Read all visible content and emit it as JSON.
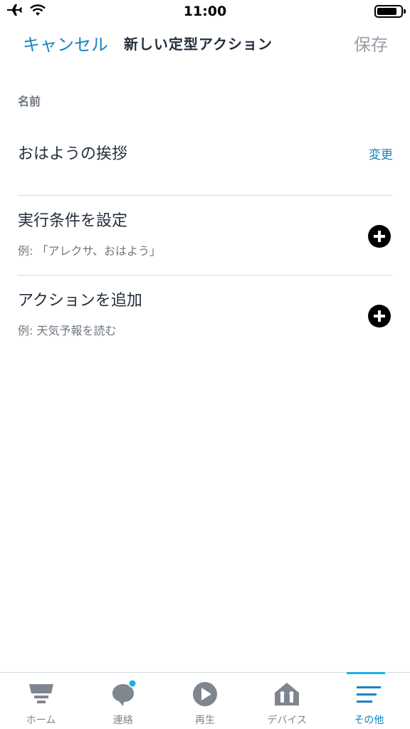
{
  "status_bar": {
    "time": "11:00",
    "icons": [
      "airplane-icon",
      "wifi-icon",
      "battery-icon"
    ]
  },
  "nav": {
    "cancel_label": "キャンセル",
    "title": "新しい定型アクション",
    "save_label": "保存"
  },
  "name_section": {
    "label": "名前",
    "value": "おはようの挨拶",
    "change_label": "変更"
  },
  "rows": [
    {
      "title": "実行条件を設定",
      "subtitle": "例: 「アレクサ、おはよう」",
      "icon": "plus-circle-icon"
    },
    {
      "title": "アクションを追加",
      "subtitle": "例: 天気予報を読む",
      "icon": "plus-circle-icon"
    }
  ],
  "tab_bar": {
    "tabs": [
      {
        "label": "ホーム",
        "icon": "home-icon",
        "active": false
      },
      {
        "label": "連絡",
        "icon": "chat-bubble-icon",
        "active": false,
        "badge": true
      },
      {
        "label": "再生",
        "icon": "play-icon",
        "active": false
      },
      {
        "label": "デバイス",
        "icon": "devices-icon",
        "active": false
      },
      {
        "label": "その他",
        "icon": "menu-icon",
        "active": true
      }
    ]
  },
  "colors": {
    "accent": "#1585bf",
    "badge": "#1bb3e6",
    "text_primary": "#232f3e",
    "text_secondary": "#6f7780",
    "disabled": "#9aa0a6"
  }
}
